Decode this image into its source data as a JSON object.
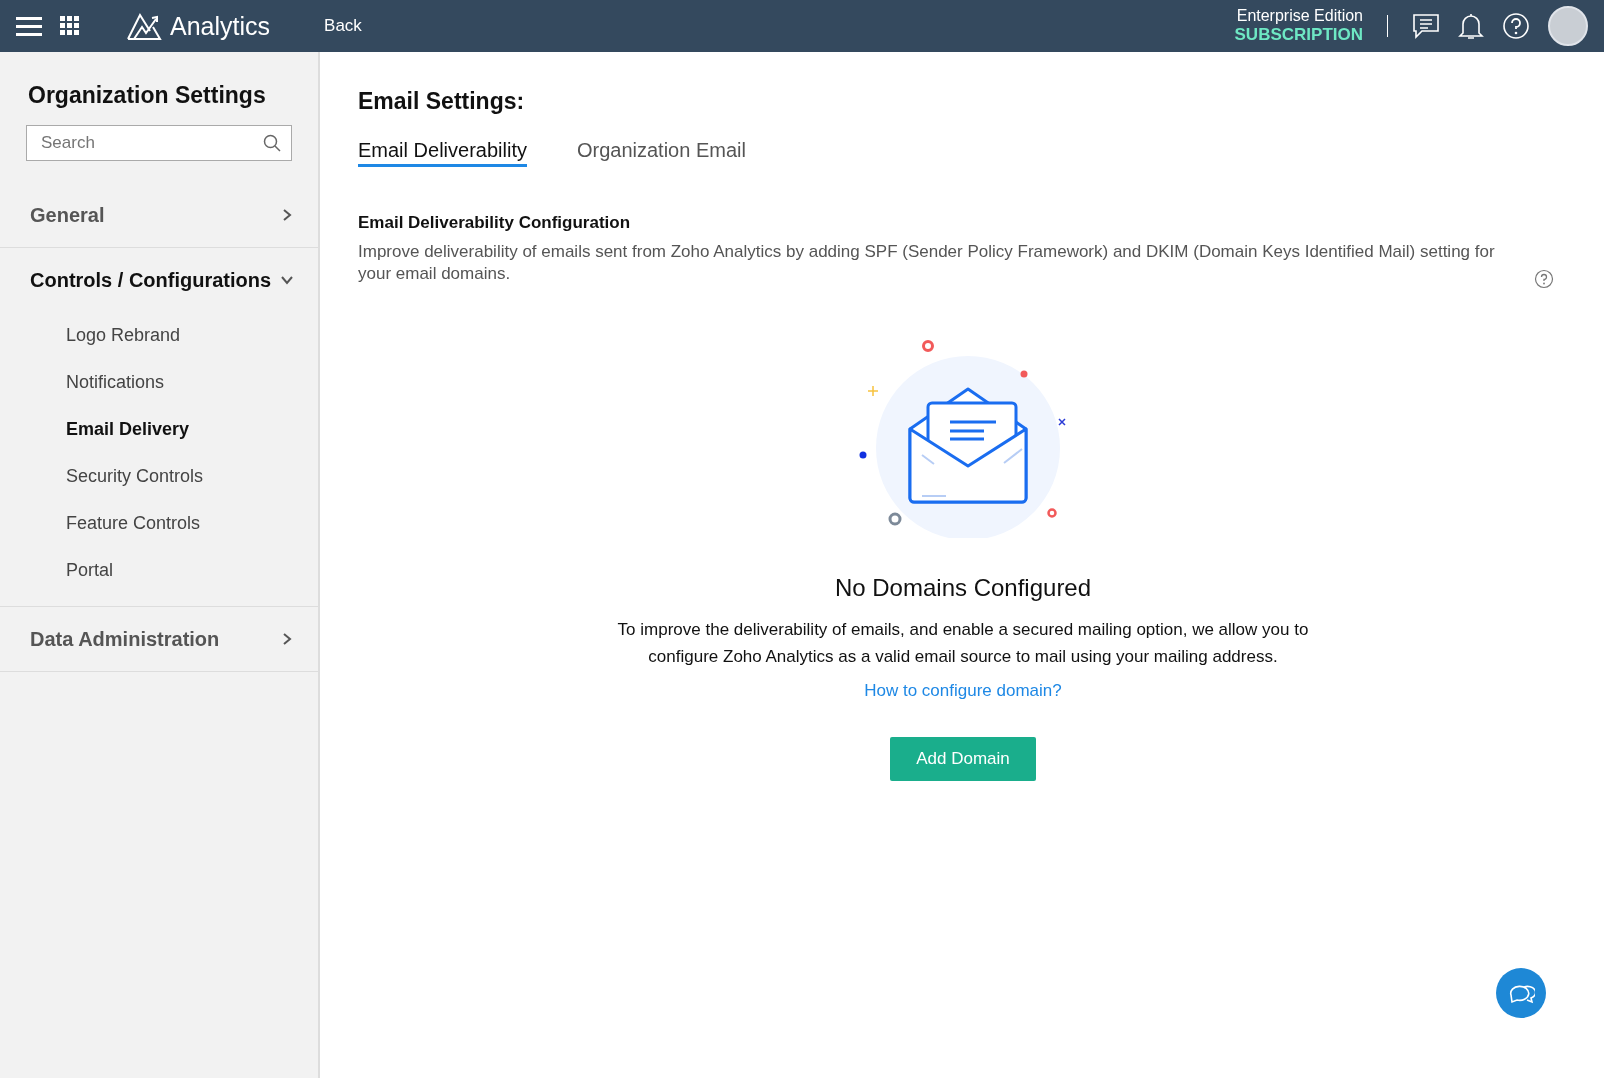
{
  "topbar": {
    "app_name": "Analytics",
    "back": "Back",
    "edition": "Enterprise Edition",
    "subscription": "SUBSCRIPTION"
  },
  "sidebar": {
    "title": "Organization Settings",
    "search": {
      "placeholder": "Search"
    },
    "sections": [
      {
        "label": "General",
        "expanded": false
      },
      {
        "label": "Controls / Configurations",
        "expanded": true,
        "items": [
          {
            "label": "Logo Rebrand",
            "selected": false
          },
          {
            "label": "Notifications",
            "selected": false
          },
          {
            "label": "Email Delivery",
            "selected": true
          },
          {
            "label": "Security Controls",
            "selected": false
          },
          {
            "label": "Feature Controls",
            "selected": false
          },
          {
            "label": "Portal",
            "selected": false
          }
        ]
      },
      {
        "label": "Data Administration",
        "expanded": false
      }
    ]
  },
  "main": {
    "title": "Email Settings:",
    "tabs": [
      {
        "label": "Email Deliverability",
        "selected": true
      },
      {
        "label": "Organization Email",
        "selected": false
      }
    ],
    "section_title": "Email Deliverability Configuration",
    "description": "Improve deliverability of emails sent from Zoho Analytics by adding SPF (Sender Policy Framework) and DKIM (Domain Keys Identified Mail) setting for your email domains.",
    "empty_title": "No Domains Configured",
    "empty_text": "To improve the deliverability of emails, and enable a secured mailing option, we allow you to configure Zoho Analytics as a valid email source to mail using your mailing address.",
    "link": "How to configure domain?",
    "button": "Add Domain"
  }
}
